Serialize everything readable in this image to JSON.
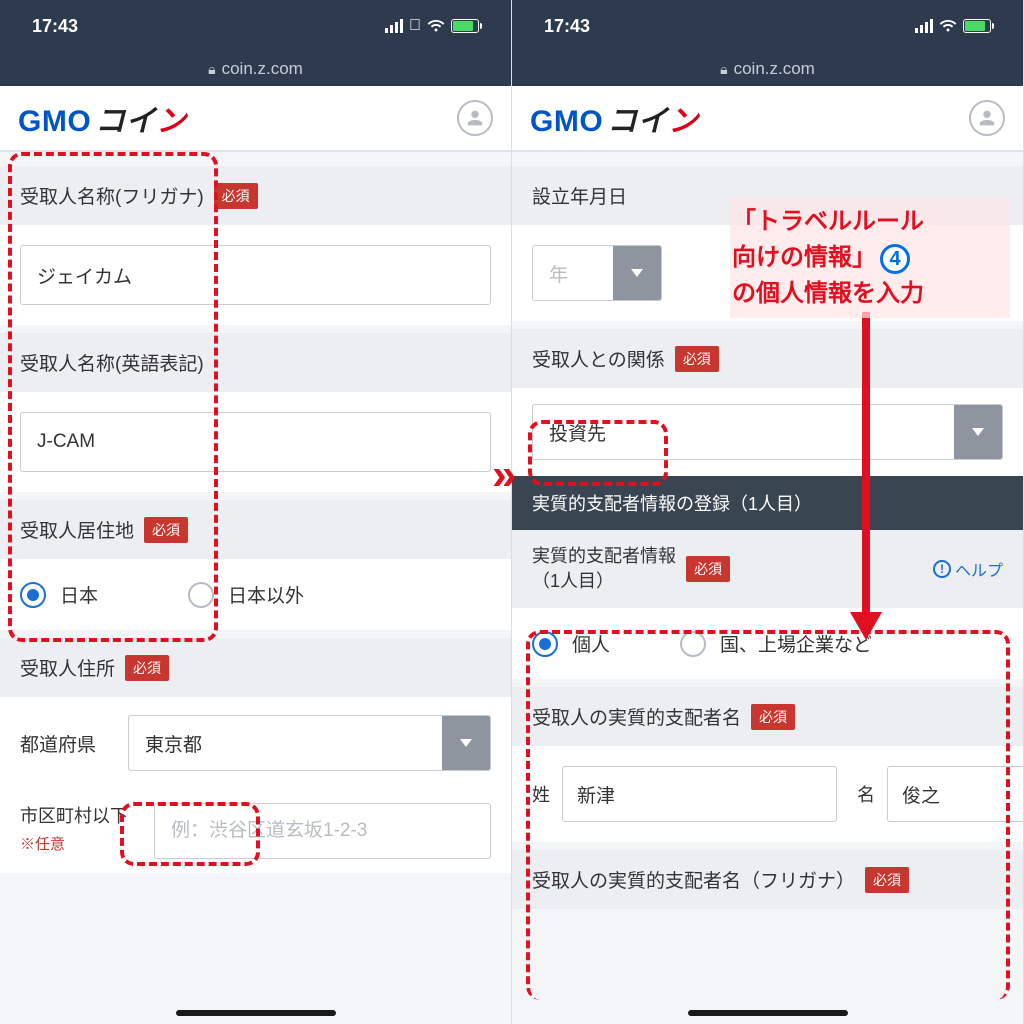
{
  "status": {
    "time": "17:43",
    "url": "coin.z.com"
  },
  "logo": {
    "gmo": "GMO",
    "co": "コイ",
    "n": "ン"
  },
  "left": {
    "furi_label": "受取人名称(フリガナ)",
    "furi_value": "ジェイカム",
    "eng_label": "受取人名称(英語表記)",
    "eng_value": "J-CAM",
    "res_label": "受取人居住地",
    "res_jp": "日本",
    "res_other": "日本以外",
    "addr_label": "受取人住所",
    "pref_lbl": "都道府県",
    "pref_val": "東京都",
    "city_lbl": "市区町村以下",
    "city_opt": "※任意",
    "city_ph": "例：渋谷区道玄坂1-2-3"
  },
  "right": {
    "est_label": "設立年月日",
    "year_ph": "年",
    "rel_label": "受取人との関係",
    "rel_val": "投資先",
    "dark_title": "実質的支配者情報の登録（1人目）",
    "ctrl_label": "実質的支配者情報\n（1人目）",
    "help": "ヘルプ",
    "opt_ind": "個人",
    "opt_corp": "国、上場企業など",
    "name_label": "受取人の実質的支配者名",
    "sei_lbl": "姓",
    "sei_val": "新津",
    "mei_lbl": "名",
    "mei_val": "俊之",
    "kana_label": "受取人の実質的支配者名（フリガナ）"
  },
  "req": "必須",
  "callout": {
    "l1": "「トラベルルール",
    "l2": "向けの情報」",
    "l3": "の個人情報を入力",
    "num": "4"
  }
}
